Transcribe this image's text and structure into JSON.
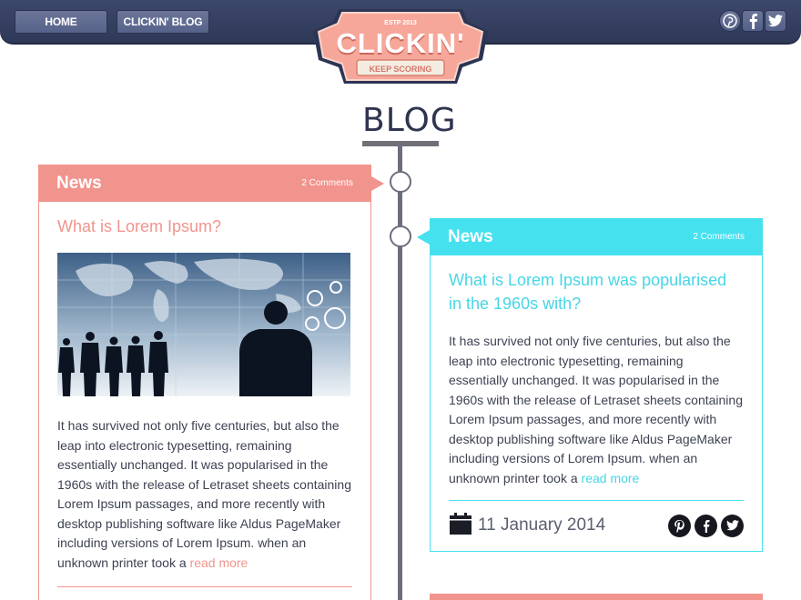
{
  "nav": {
    "home_label": "HOME",
    "blog_label": "CLICKIN' BLOG"
  },
  "social": {
    "icons": [
      "pinterest-icon",
      "facebook-icon",
      "twitter-icon"
    ]
  },
  "logo": {
    "established": "ESTP 2013",
    "name": "CLICKIN'",
    "tagline": "KEEP SCORING"
  },
  "page_title": "BLOG",
  "posts": [
    {
      "category": "News",
      "comments": "2 Comments",
      "title": "What is Lorem Ipsum?",
      "body": "It has survived not only five centuries, but also the leap into electronic typesetting, remaining essentially unchanged. It was popularised in the 1960s with the release of Letraset sheets containing Lorem Ipsum passages, and more recently with desktop publishing software like Aldus PageMaker including versions of Lorem Ipsum. when an unknown printer took a",
      "read_more": "read more",
      "accent": "#f1948d"
    },
    {
      "category": "News",
      "comments": "2 Comments",
      "title": "What is Lorem Ipsum was popularised in the 1960s with?",
      "body": "It has survived not only five centuries, but also the leap into electronic typesetting, remaining essentially unchanged. It was popularised in the 1960s with the release of Letraset sheets containing Lorem Ipsum passages, and more recently with desktop publishing software like Aldus PageMaker including versions of Lorem Ipsum. when an unknown printer took a",
      "read_more": "read more",
      "date": "11 January 2014",
      "accent": "#46e1ef"
    }
  ],
  "colors": {
    "header": "#343f62",
    "pink": "#f1948d",
    "cyan": "#46e1ef",
    "timeline": "#6b6f7c"
  }
}
